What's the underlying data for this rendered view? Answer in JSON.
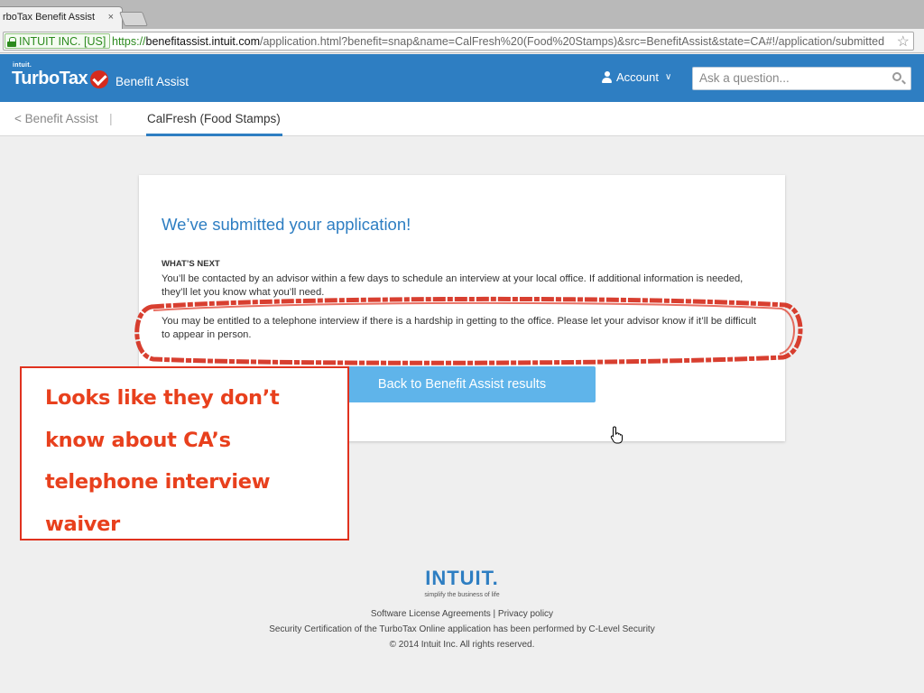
{
  "browser": {
    "tab_title": "rboTax Benefit Assist",
    "tab_close": "×",
    "ev_label": "INTUIT INC. [US]",
    "url_scheme": "https://",
    "url_host": "benefitassist.intuit.com",
    "url_path": "/application.html?benefit=snap&name=CalFresh%20(Food%20Stamps)&src=BenefitAssist&state=CA#!/application/submitted",
    "star": "☆"
  },
  "header": {
    "intuit_small": "intuit.",
    "brand": "TurboTax",
    "product": "Benefit Assist",
    "account_label": "Account",
    "account_chevron": "∨",
    "search_placeholder": "Ask a question...",
    "brand_color": "#2e7ec2"
  },
  "subnav": {
    "back_label": "< Benefit Assist",
    "separator": "|",
    "active_tab": "CalFresh (Food Stamps)"
  },
  "card": {
    "heading": "We’ve submitted your application!",
    "section_label": "WHAT’S NEXT",
    "paragraph1": "You’ll be contacted by an advisor within a few days to schedule an interview at your local office. If additional information is needed, they’ll let you know what you’ll need.",
    "paragraph2": "You may be entitled to a telephone interview if there is a hardship in getting to the office. Please let your advisor know if it’ll be difficult to appear in person.",
    "button_label": "Back to Benefit Assist results",
    "button_color": "#5fb4ea"
  },
  "annotation": {
    "lines": [
      "Looks like they don’t",
      "know about CA’s",
      "telephone interview",
      "waiver"
    ],
    "color": "#e0321f"
  },
  "footer": {
    "logo": "INTUIT.",
    "tagline": "simplify the business of life",
    "links": "Software License Agreements | Privacy policy",
    "certification": "Security Certification of the TurboTax Online application has been performed by C-Level Security",
    "copyright": "© 2014 Intuit Inc. All rights reserved."
  }
}
